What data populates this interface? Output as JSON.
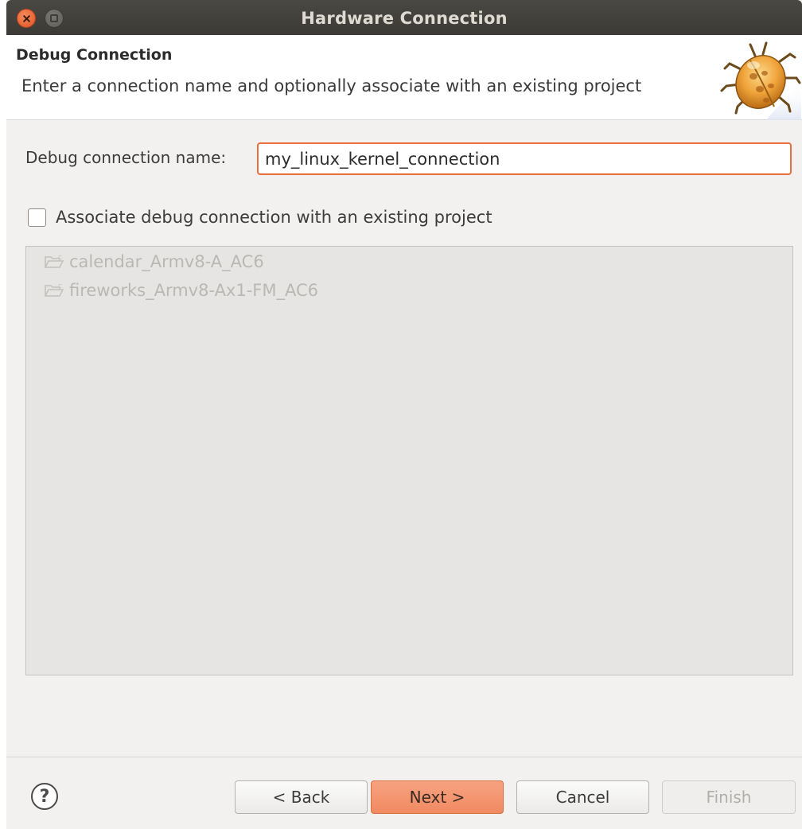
{
  "window": {
    "title": "Hardware Connection"
  },
  "header": {
    "heading": "Debug Connection",
    "description": "Enter a connection name and optionally associate with an existing project",
    "banner_icon": "bug-icon"
  },
  "form": {
    "name_label": "Debug connection name:",
    "name_value": "my_linux_kernel_connection",
    "associate_label": "Associate debug connection with an existing project",
    "associate_checked": false
  },
  "projects": [
    {
      "name": "calendar_Armv8-A_AC6",
      "icon": "folder-icon"
    },
    {
      "name": "fireworks_Armv8-Ax1-FM_AC6",
      "icon": "folder-icon"
    }
  ],
  "buttons": {
    "help": "?",
    "back": "< Back",
    "next": "Next >",
    "cancel": "Cancel",
    "finish": "Finish"
  },
  "colors": {
    "accent": "#f08a62",
    "input_focus_border": "#e8703c",
    "titlebar": "#3c3b37"
  }
}
